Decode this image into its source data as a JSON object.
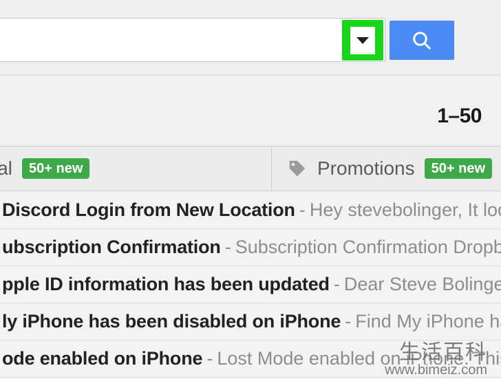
{
  "toolbar": {
    "page_indicator": "1–50"
  },
  "tabs": {
    "social": {
      "label_fragment": "ial",
      "badge": "50+ new"
    },
    "promotions": {
      "label": "Promotions",
      "badge": "50+ new"
    }
  },
  "emails": [
    {
      "subject_fragment": "Discord Login from New Location",
      "snippet_fragment": "Hey stevebolinger, It looks like"
    },
    {
      "subject_fragment": "ubscription Confirmation",
      "snippet_fragment": "Subscription Confirmation Dropbox"
    },
    {
      "subject_fragment": "pple ID information has been updated",
      "snippet_fragment": "Dear Steve Bolinger,"
    },
    {
      "subject_fragment": "ly iPhone has been disabled on iPhone",
      "snippet_fragment": "Find My iPhone has"
    },
    {
      "subject_fragment": "ode enabled on iPhone",
      "snippet_fragment": "Lost Mode enabled on iPhone. This"
    }
  ],
  "watermark": {
    "line1": "生活百科",
    "line2": "www.bimeiz.com"
  },
  "colors": {
    "highlight_green": "#1ad61a",
    "search_blue": "#4a8af4",
    "badge_green": "#3da949"
  }
}
